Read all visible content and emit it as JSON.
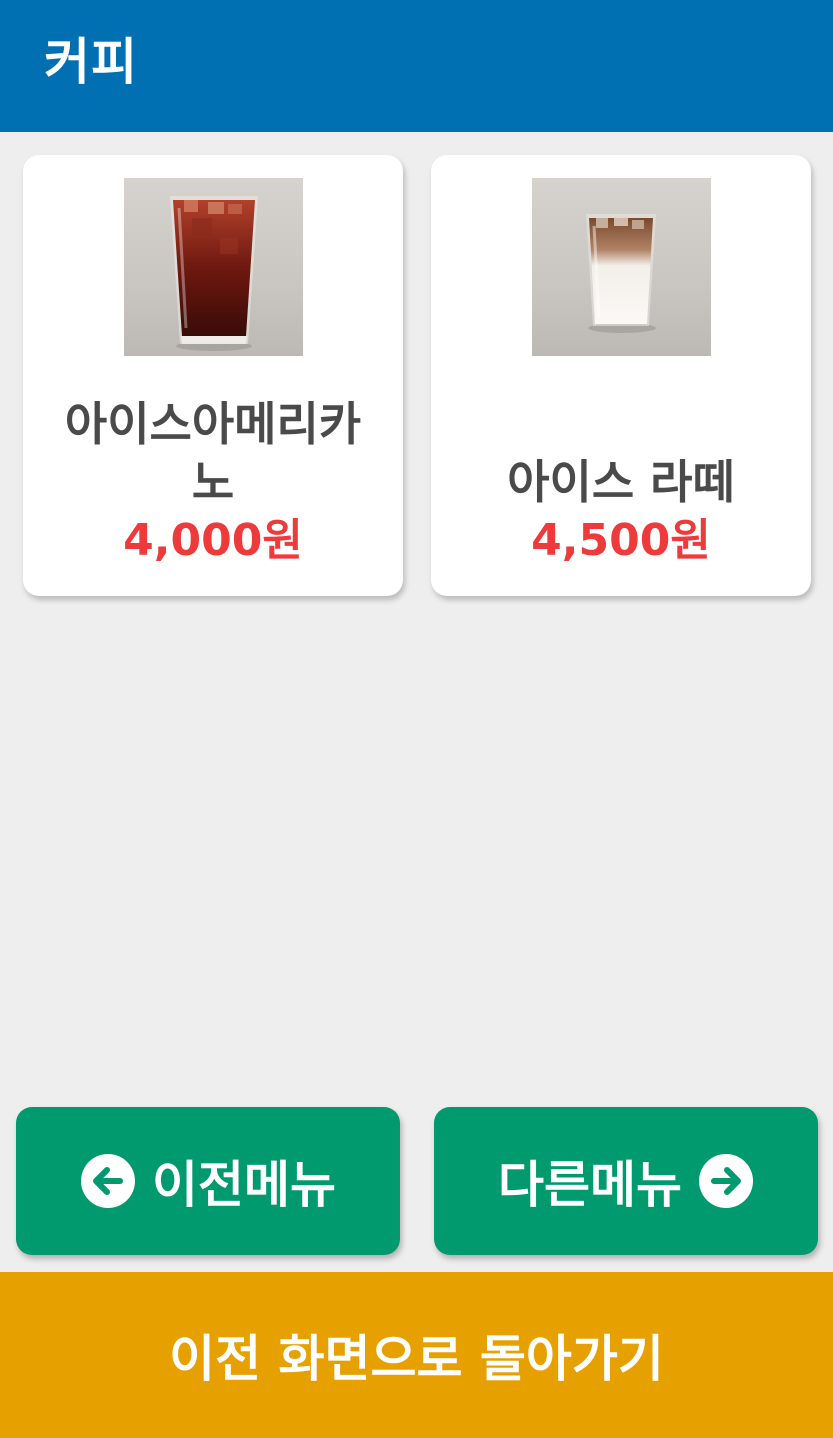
{
  "header": {
    "title": "커피"
  },
  "products": [
    {
      "name": "아이스아메리카노",
      "price": "4,000원",
      "image": "iced-americano-image"
    },
    {
      "name": "아이스 라떼",
      "price": "4,500원",
      "image": "iced-latte-image"
    }
  ],
  "nav": {
    "prev_label": "이전메뉴",
    "prev_icon": "arrow-left-circle-icon",
    "next_label": "다른메뉴",
    "next_icon": "arrow-right-circle-icon"
  },
  "footer": {
    "back_label": "이전 화면으로 돌아가기"
  },
  "colors": {
    "header": "#0070b2",
    "nav_button": "#009a6e",
    "footer": "#e6a000",
    "price": "#ee3a3a",
    "background": "#eeeeee"
  }
}
